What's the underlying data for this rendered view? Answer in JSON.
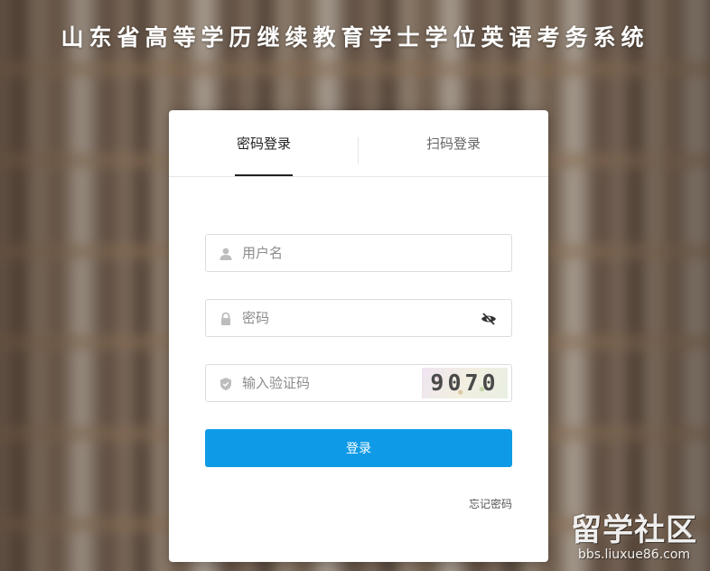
{
  "header": {
    "title": "山东省高等学历继续教育学士学位英语考务系统"
  },
  "login": {
    "tabs": [
      {
        "label": "密码登录",
        "active": true
      },
      {
        "label": "扫码登录",
        "active": false
      }
    ],
    "username": {
      "placeholder": "用户名",
      "value": "",
      "icon": "user-icon"
    },
    "password": {
      "placeholder": "密码",
      "value": "",
      "icon": "lock-icon",
      "toggle_icon": "eye-slash-icon"
    },
    "captcha": {
      "placeholder": "输入验证码",
      "value": "",
      "icon": "shield-icon",
      "image_text": "9070"
    },
    "submit_label": "登录",
    "forgot_label": "忘记密码"
  },
  "watermark": {
    "name": "留学社区",
    "url": "bbs.liuxue86.com"
  },
  "colors": {
    "primary": "#0e9ae6",
    "card_bg": "#ffffff",
    "title_text": "#ffffff"
  }
}
